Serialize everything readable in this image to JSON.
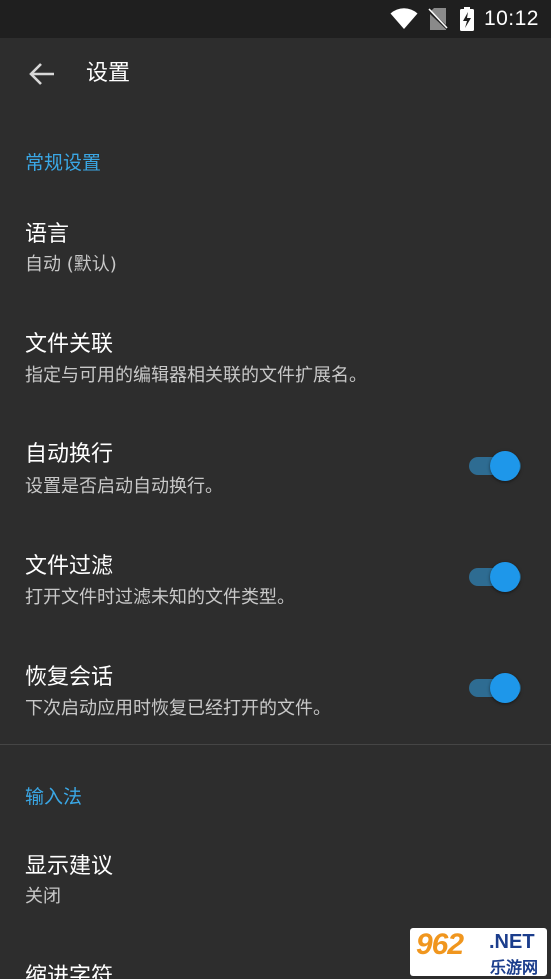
{
  "status_bar": {
    "time": "10:12",
    "icons": [
      "wifi-icon",
      "no-sim-icon",
      "battery-charging-icon"
    ]
  },
  "toolbar": {
    "back_icon": "arrow-back-icon",
    "title": "设置"
  },
  "sections": {
    "general": {
      "header": "常规设置",
      "language": {
        "title": "语言",
        "summary": "自动 (默认)"
      },
      "file_association": {
        "title": "文件关联",
        "summary": "指定与可用的编辑器相关联的文件扩展名。"
      },
      "word_wrap": {
        "title": "自动换行",
        "summary": "设置是否启动自动换行。",
        "enabled": true
      },
      "file_filter": {
        "title": "文件过滤",
        "summary": "打开文件时过滤未知的文件类型。",
        "enabled": true
      },
      "restore_session": {
        "title": "恢复会话",
        "summary": "下次启动应用时恢复已经打开的文件。",
        "enabled": true
      }
    },
    "input_method": {
      "header": "输入法",
      "show_suggestions": {
        "title": "显示建议",
        "summary": "关闭"
      },
      "indent_char": {
        "title": "缩进字符"
      }
    }
  },
  "watermark": {
    "number": "962",
    "domain": ".NET",
    "cn": "乐游网"
  },
  "colors": {
    "background": "#2d2d2d",
    "status_bar": "#1f1f1f",
    "accent": "#3aa7e5",
    "switch_thumb": "#1e97ea",
    "switch_track": "#2e6c92"
  }
}
